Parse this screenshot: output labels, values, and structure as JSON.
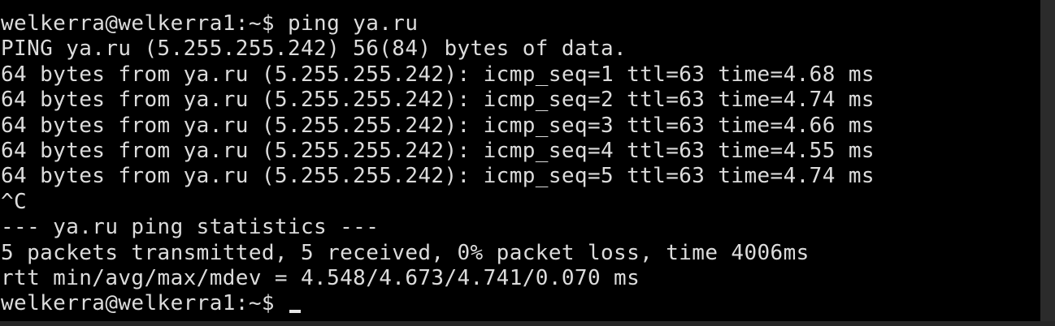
{
  "terminal": {
    "lines": [
      "welkerra@welkerra1:~$ ping ya.ru",
      "PING ya.ru (5.255.255.242) 56(84) bytes of data.",
      "64 bytes from ya.ru (5.255.255.242): icmp_seq=1 ttl=63 time=4.68 ms",
      "64 bytes from ya.ru (5.255.255.242): icmp_seq=2 ttl=63 time=4.74 ms",
      "64 bytes from ya.ru (5.255.255.242): icmp_seq=3 ttl=63 time=4.66 ms",
      "64 bytes from ya.ru (5.255.255.242): icmp_seq=4 ttl=63 time=4.55 ms",
      "64 bytes from ya.ru (5.255.255.242): icmp_seq=5 ttl=63 time=4.74 ms",
      "^C",
      "--- ya.ru ping statistics ---",
      "5 packets transmitted, 5 received, 0% packet loss, time 4006ms",
      "rtt min/avg/max/mdev = 4.548/4.673/4.741/0.070 ms"
    ],
    "prompt": "welkerra@welkerra1:~$ ",
    "colors": {
      "background": "#000000",
      "text": "#dcdcdc",
      "cursor": "#e6e6e6"
    }
  }
}
